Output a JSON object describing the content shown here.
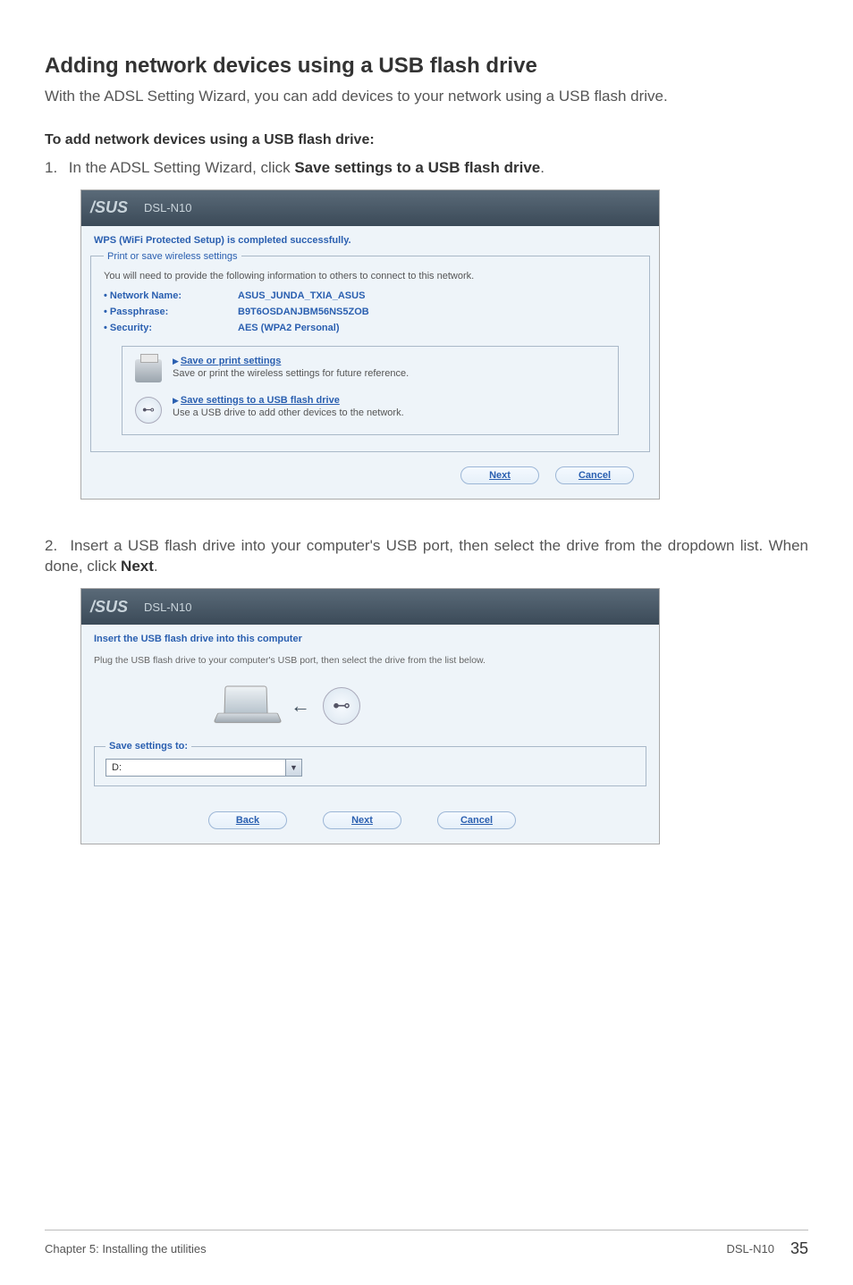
{
  "heading": "Adding network devices using a USB flash drive",
  "intro": "With the ADSL Setting Wizard, you can add devices to your network using a USB flash drive.",
  "subhead": "To add network devices using a USB flash drive:",
  "step1_prefix": "1.",
  "step1_text": "In the ADSL Setting Wizard, click ",
  "step1_bold": "Save settings to a USB flash drive",
  "step1_suffix": ".",
  "shot1": {
    "model": "DSL-N10",
    "success": "WPS (WiFi Protected Setup) is completed successfully.",
    "legend": "Print or save wireless settings",
    "info": "You will need to provide the following information to others to connect to this network.",
    "kv": [
      {
        "label": "• Network Name:",
        "value": "ASUS_JUNDA_TXIA_ASUS"
      },
      {
        "label": "• Passphrase:",
        "value": "B9T6OSDANJBM56NS5ZOB"
      },
      {
        "label": "• Security:",
        "value": "AES (WPA2 Personal)"
      }
    ],
    "opt1_title": "Save or print settings",
    "opt1_desc": "Save or print the wireless settings for future reference.",
    "opt2_title": "Save settings to a USB flash drive",
    "opt2_desc": "Use a USB drive to add other devices to the network.",
    "btn_next": "Next",
    "btn_cancel": "Cancel"
  },
  "step2_prefix": "2.",
  "step2_text": "Insert a USB flash drive into your computer's USB port, then select the drive from the dropdown list. When done, click ",
  "step2_bold": "Next",
  "step2_suffix": ".",
  "shot2": {
    "model": "DSL-N10",
    "title": "Insert the USB flash drive into this computer",
    "desc": "Plug the USB flash drive to your computer's USB port, then select the drive from the list below.",
    "legend": "Save settings to:",
    "drive": "D:",
    "btn_back": "Back",
    "btn_next": "Next",
    "btn_cancel": "Cancel"
  },
  "footer": {
    "left": "Chapter 5: Installing the utilities",
    "product": "DSL-N10",
    "page": "35"
  },
  "asus_brand": "/SUS"
}
